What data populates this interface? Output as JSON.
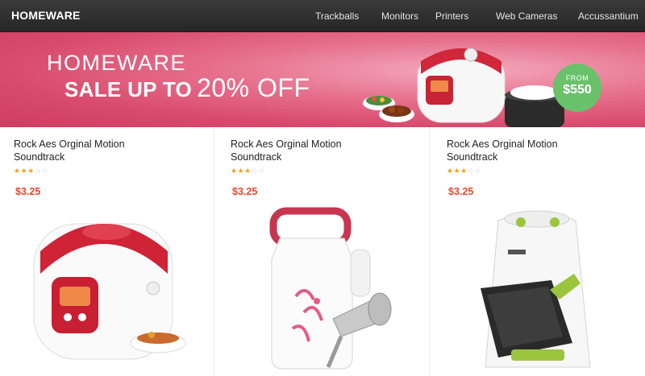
{
  "header": {
    "brand": "HOMEWARE",
    "nav": [
      "Trackballs",
      "Monitors",
      "Printers",
      "Web Cameras",
      "Accussantium"
    ]
  },
  "banner": {
    "line1": "HOMEWARE",
    "line2_bold": "SALE UP TO",
    "line2_light": "20% OFF",
    "badge_from": "FROM",
    "badge_price": "$550"
  },
  "products": [
    {
      "title": "Rock Aes Orginal Motion Soundtrack",
      "rating": 3,
      "rating_max": 5,
      "price": "$3.25",
      "image": "rice-cooker"
    },
    {
      "title": "Rock Aes Orginal Motion Soundtrack",
      "rating": 3,
      "rating_max": 5,
      "price": "$3.25",
      "image": "soymilk-maker"
    },
    {
      "title": "Rock Aes Orginal Motion Soundtrack",
      "rating": 3,
      "rating_max": 5,
      "price": "$3.25",
      "image": "air-fryer"
    }
  ],
  "colors": {
    "topbar": "#2f2f2f",
    "banner": "#d94a6c",
    "badge": "#69c16a",
    "price": "#e8462e",
    "star": "#f0a020"
  }
}
